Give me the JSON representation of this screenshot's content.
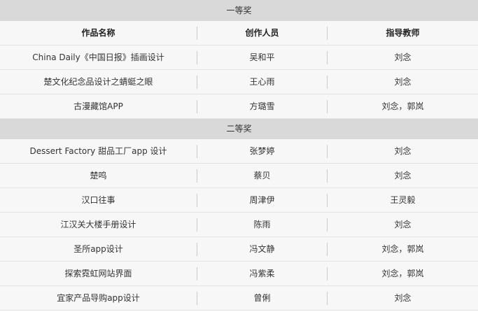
{
  "header": {
    "col1": "作品名称",
    "col2": "创作人员",
    "col3": "指导教师"
  },
  "sections": [
    {
      "title": "一等奖",
      "rows": [
        [
          "China Daily《中国日报》插画设计",
          "吴和平",
          "刘念"
        ],
        [
          "楚文化纪念品设计之蜻蜓之眼",
          "王心雨",
          "刘念"
        ],
        [
          "古漫藏馆APP",
          "方璐雪",
          "刘念，郭岚"
        ]
      ]
    },
    {
      "title": "二等奖",
      "rows": [
        [
          "Dessert Factory 甜品工厂app 设计",
          "张梦婷",
          "刘念"
        ],
        [
          "楚鸣",
          "蔡贝",
          "刘念"
        ],
        [
          "汉口往事",
          "周津伊",
          "王灵毅"
        ],
        [
          "江汉关大楼手册设计",
          "陈雨",
          "刘念"
        ],
        [
          "圣所app设计",
          "冯文静",
          "刘念，郭岚"
        ],
        [
          "探索霓虹网站界面",
          "冯紫柔",
          "刘念，郭岚"
        ],
        [
          "宜家产品导购app设计",
          "曾俐",
          "刘念"
        ]
      ]
    }
  ]
}
